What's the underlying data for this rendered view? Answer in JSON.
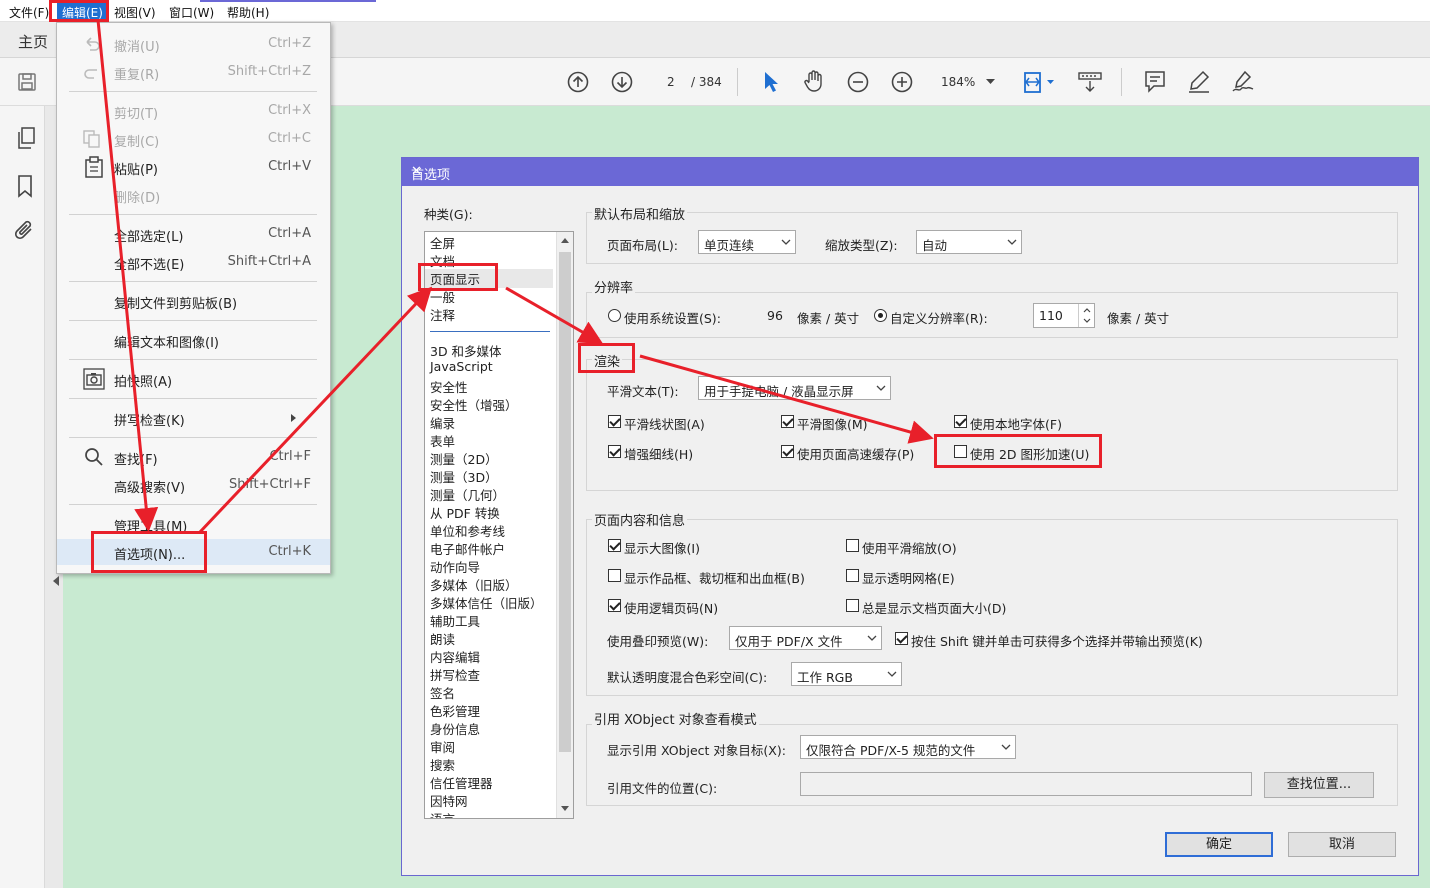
{
  "menubar": {
    "items": [
      "文件(F)",
      "编辑(E)",
      "视图(V)",
      "窗口(W)",
      "帮助(H)"
    ]
  },
  "tabs": {
    "home": "主页"
  },
  "toolbar": {
    "page_current": "2",
    "page_total": "/ 384",
    "zoom": "184%"
  },
  "edit_menu": {
    "undo": {
      "label": "撤消(U)",
      "shortcut": "Ctrl+Z"
    },
    "redo": {
      "label": "重复(R)",
      "shortcut": "Shift+Ctrl+Z"
    },
    "cut": {
      "label": "剪切(T)",
      "shortcut": "Ctrl+X"
    },
    "copy": {
      "label": "复制(C)",
      "shortcut": "Ctrl+C"
    },
    "paste": {
      "label": "粘贴(P)",
      "shortcut": "Ctrl+V"
    },
    "delete": {
      "label": "删除(D)"
    },
    "select_all": {
      "label": "全部选定(L)",
      "shortcut": "Ctrl+A"
    },
    "deselect_all": {
      "label": "全部不选(E)",
      "shortcut": "Shift+Ctrl+A"
    },
    "copy_file": {
      "label": "复制文件到剪贴板(B)"
    },
    "edit_text": {
      "label": "编辑文本和图像(I)"
    },
    "snapshot": {
      "label": "拍快照(A)"
    },
    "spellcheck": {
      "label": "拼写检查(K)"
    },
    "find": {
      "label": "查找(F)",
      "shortcut": "Ctrl+F"
    },
    "advanced_search": {
      "label": "高级搜索(V)",
      "shortcut": "Shift+Ctrl+F"
    },
    "manage_tools": {
      "label": "管理工具(M)"
    },
    "preferences": {
      "label": "首选项(N)...",
      "shortcut": "Ctrl+K"
    }
  },
  "dialog": {
    "title": "首选项",
    "categories_label": "种类(G):",
    "categories_top": [
      "全屏",
      "文档",
      "页面显示",
      "一般",
      "注释"
    ],
    "categories": [
      "3D 和多媒体",
      "JavaScript",
      "安全性",
      "安全性（增强）",
      "编录",
      "表单",
      "测量（2D）",
      "测量（3D）",
      "测量（几何）",
      "从 PDF 转换",
      "单位和参考线",
      "电子邮件帐户",
      "动作向导",
      "多媒体（旧版）",
      "多媒体信任（旧版）",
      "辅助工具",
      "朗读",
      "内容编辑",
      "拼写检查",
      "签名",
      "色彩管理",
      "身份信息",
      "审阅",
      "搜索",
      "信任管理器",
      "因特网",
      "语言"
    ],
    "layout_group": {
      "title": "默认布局和缩放",
      "page_layout_label": "页面布局(L):",
      "page_layout_value": "单页连续",
      "zoom_type_label": "缩放类型(Z):",
      "zoom_type_value": "自动"
    },
    "resolution_group": {
      "title": "分辨率",
      "system_label": "使用系统设置(S):",
      "system_value": "96",
      "unit1": "像素 / 英寸",
      "custom_label": "自定义分辨率(R):",
      "custom_value": "110",
      "unit2": "像素 / 英寸"
    },
    "render_group": {
      "title": "渲染",
      "smooth_text_label": "平滑文本(T):",
      "smooth_text_value": "用于手提电脑 / 液晶显示屏",
      "smooth_line": "平滑线状图(A)",
      "smooth_image": "平滑图像(M)",
      "local_fonts": "使用本地字体(F)",
      "thin_lines": "增强细线(H)",
      "page_cache": "使用页面高速缓存(P)",
      "gpu_2d": "使用 2D 图形加速(U)"
    },
    "content_group": {
      "title": "页面内容和信息",
      "large_images": "显示大图像(I)",
      "smooth_zoom": "使用平滑缩放(O)",
      "art_boxes": "显示作品框、裁切框和出血框(B)",
      "transparency_grid": "显示透明网格(E)",
      "logical_page": "使用逻辑页码(N)",
      "doc_page_size": "总是显示文档页面大小(D)",
      "overprint_label": "使用叠印预览(W):",
      "overprint_value": "仅用于 PDF/X 文件",
      "shift_preview": "按住 Shift 键并单击可获得多个选择并带输出预览(K)",
      "blend_label": "默认透明度混合色彩空间(C):",
      "blend_value": "工作 RGB"
    },
    "xobject_group": {
      "title": "引用 XObject 对象查看模式",
      "show_label": "显示引用 XObject 对象目标(X):",
      "show_value": "仅限符合 PDF/X-5 规范的文件",
      "location_label": "引用文件的位置(C):",
      "browse": "查找位置..."
    },
    "ok": "确定",
    "cancel": "取消"
  },
  "colors": {
    "dialog_title_bar": "#6b68d6",
    "annotation_red": "#e8202a",
    "document_background": "#c8ead1",
    "toolbar_blue": "#1f6fd1"
  }
}
